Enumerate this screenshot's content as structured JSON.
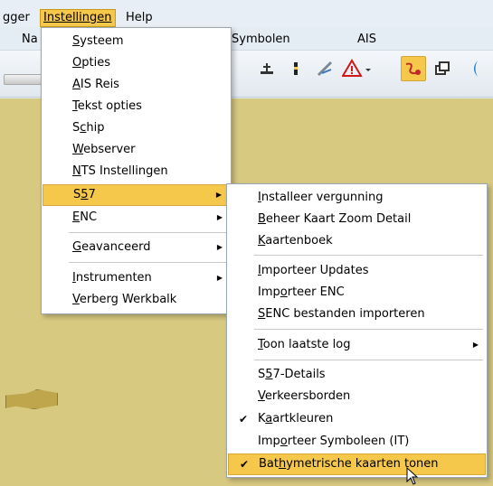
{
  "menubar": {
    "items": [
      {
        "label": "gger"
      },
      {
        "label": "Instellingen"
      },
      {
        "label": "Help"
      }
    ]
  },
  "secondary_bar": {
    "items": [
      {
        "label": "Na"
      },
      {
        "label": "Symbolen"
      },
      {
        "label": "AIS"
      }
    ]
  },
  "toolbar": {
    "icons": [
      "anchor-icon",
      "beacon-icon",
      "chart-tools-icon",
      "warning-icon",
      "route-icon",
      "layers-icon",
      "user-icon"
    ]
  },
  "instellingen_menu": {
    "items": [
      {
        "pre": "",
        "acc": "S",
        "post": "ysteem"
      },
      {
        "pre": "",
        "acc": "O",
        "post": "pties"
      },
      {
        "pre": "",
        "acc": "A",
        "post": "IS Reis"
      },
      {
        "pre": "",
        "acc": "T",
        "post": "ekst opties"
      },
      {
        "pre": "S",
        "acc": "c",
        "post": "hip"
      },
      {
        "pre": "",
        "acc": "W",
        "post": "ebserver"
      },
      {
        "pre": "",
        "acc": "N",
        "post": "TS Instellingen"
      },
      {
        "pre": "S",
        "acc": "5",
        "post": "7"
      },
      {
        "pre": "",
        "acc": "E",
        "post": "NC"
      },
      {
        "pre": "",
        "acc": "G",
        "post": "eavanceerd"
      },
      {
        "pre": "",
        "acc": "I",
        "post": "nstrumenten"
      },
      {
        "pre": "",
        "acc": "V",
        "post": "erberg Werkbalk"
      }
    ]
  },
  "s57_menu": {
    "items": [
      {
        "pre": "",
        "acc": "I",
        "post": "nstalleer vergunning"
      },
      {
        "pre": "",
        "acc": "B",
        "post": "eheer Kaart Zoom Detail"
      },
      {
        "pre": "",
        "acc": "K",
        "post": "aartenboek"
      },
      {
        "pre": "",
        "acc": "I",
        "post": "mporteer Updates"
      },
      {
        "pre": "Imp",
        "acc": "o",
        "post": "rteer ENC"
      },
      {
        "pre": "",
        "acc": "S",
        "post": "ENC bestanden importeren"
      },
      {
        "pre": "",
        "acc": "T",
        "post": "oon laatste log"
      },
      {
        "pre": "S",
        "acc": "5",
        "post": "7-Details"
      },
      {
        "pre": "",
        "acc": "V",
        "post": "erkeersborden"
      },
      {
        "pre": "K",
        "acc": "a",
        "post": "artkleuren"
      },
      {
        "pre": "Imp",
        "acc": "o",
        "post": "rteer Symboleen (IT)"
      },
      {
        "pre": "Bat",
        "acc": "h",
        "post": "ymetrische kaarten tonen"
      }
    ]
  },
  "colors": {
    "highlight": "#f5c84b",
    "chart_background": "#d8c980",
    "menubar": "#e7eef5"
  }
}
